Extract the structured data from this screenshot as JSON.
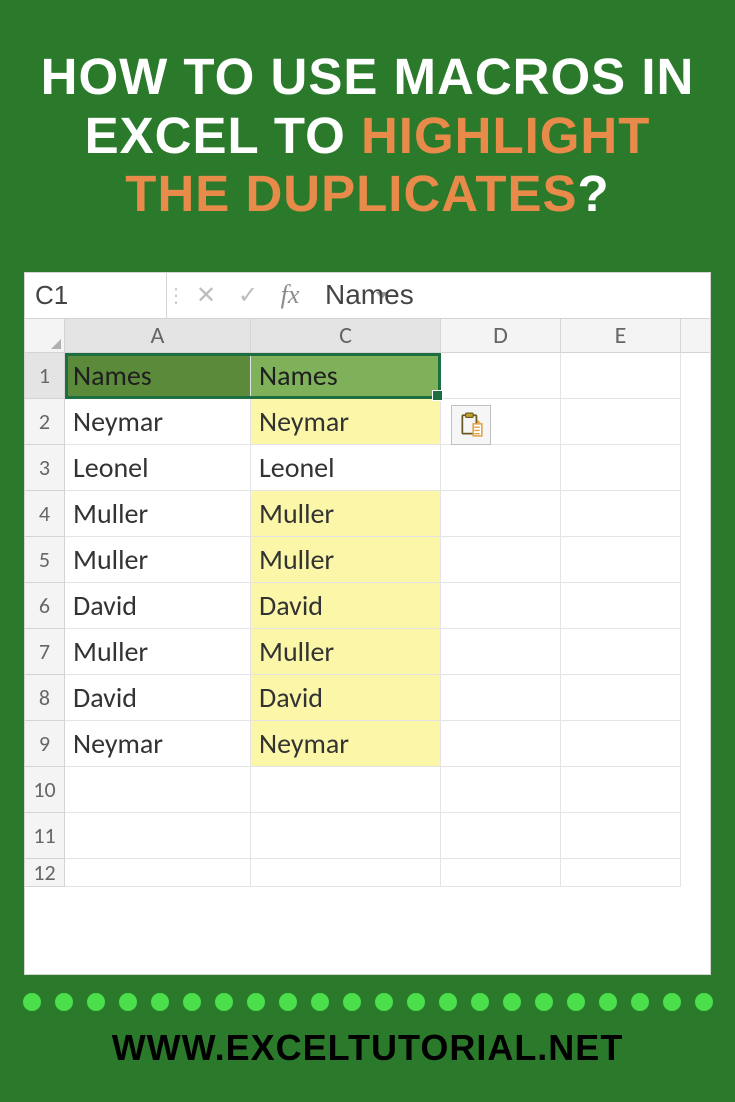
{
  "title": {
    "part1": "HOW TO USE MACROS IN EXCEL TO ",
    "accent": "HIGHLIGHT THE DUPLICATES",
    "part2": "?"
  },
  "formula_bar": {
    "namebox": "C1",
    "value": "Names"
  },
  "columns": [
    "A",
    "C",
    "D",
    "E"
  ],
  "rows": [
    {
      "num": "1",
      "a": "Names",
      "c": "Names",
      "a_cls": "hdr-green-dark",
      "c_cls": "hdr-green-light",
      "sel": true
    },
    {
      "num": "2",
      "a": "Neymar",
      "c": "Neymar",
      "c_cls": "hl-yellow"
    },
    {
      "num": "3",
      "a": "Leonel",
      "c": "Leonel"
    },
    {
      "num": "4",
      "a": "Muller",
      "c": "Muller",
      "c_cls": "hl-yellow"
    },
    {
      "num": "5",
      "a": "Muller",
      "c": "Muller",
      "c_cls": "hl-yellow"
    },
    {
      "num": "6",
      "a": "David",
      "c": "David",
      "c_cls": "hl-yellow"
    },
    {
      "num": "7",
      "a": "Muller",
      "c": "Muller",
      "c_cls": "hl-yellow"
    },
    {
      "num": "8",
      "a": "David",
      "c": "David",
      "c_cls": "hl-yellow"
    },
    {
      "num": "9",
      "a": "Neymar",
      "c": "Neymar",
      "c_cls": "hl-yellow"
    },
    {
      "num": "10",
      "a": "",
      "c": ""
    },
    {
      "num": "11",
      "a": "",
      "c": ""
    },
    {
      "num": "12",
      "a": "",
      "c": "",
      "short": true
    }
  ],
  "icons": {
    "cancel": "✕",
    "confirm": "✓",
    "fx": "fx",
    "sep": "⋮"
  },
  "dot_count": 22,
  "footer": "WWW.EXCELTUTORIAL.NET"
}
